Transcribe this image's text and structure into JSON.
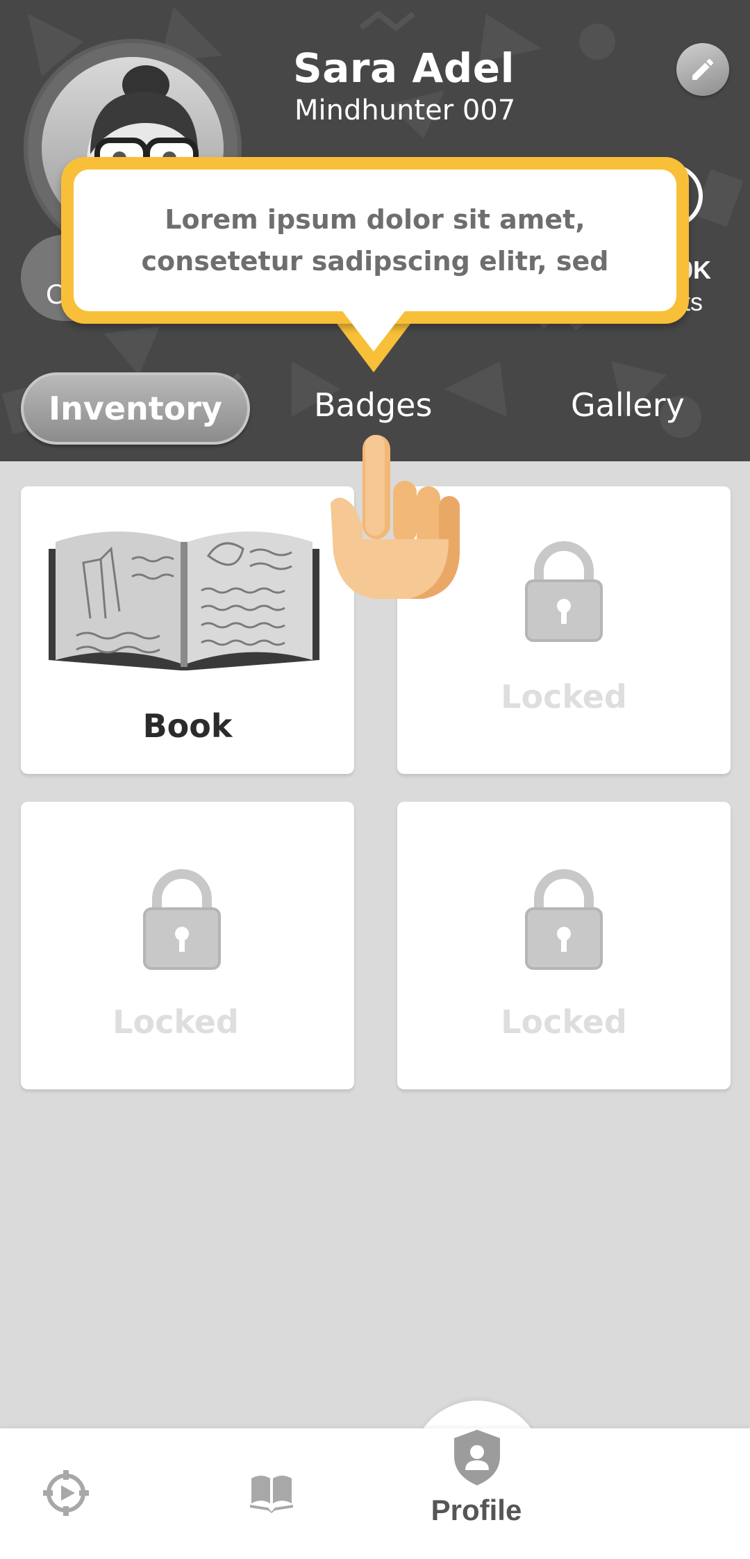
{
  "profile": {
    "name": "Sara Adel",
    "subtitle": "Mindhunter 007"
  },
  "stats": {
    "left_partial": "C",
    "right_value_partial": "0K",
    "right_label_partial": "ts"
  },
  "tooltip": {
    "text": "Lorem ipsum dolor sit amet, consetetur sadipscing elitr, sed"
  },
  "tabs": [
    {
      "label": "Inventory",
      "active": true
    },
    {
      "label": "Badges",
      "active": false
    },
    {
      "label": "Gallery",
      "active": false
    }
  ],
  "items": [
    {
      "label": "Book",
      "locked": false,
      "icon": "open-book-icon"
    },
    {
      "label": "Locked",
      "locked": true,
      "icon": "lock-icon"
    },
    {
      "label": "Locked",
      "locked": true,
      "icon": "lock-icon"
    },
    {
      "label": "Locked",
      "locked": true,
      "icon": "lock-icon"
    }
  ],
  "bottom_nav": {
    "items": [
      {
        "icon": "play-target-icon"
      },
      {
        "icon": "book-icon"
      },
      {
        "icon": "shield-user-icon",
        "label": "Profile",
        "active": true
      }
    ]
  },
  "colors": {
    "header_bg": "#474747",
    "tooltip_border": "#f8bf38",
    "content_bg": "#dadada"
  }
}
